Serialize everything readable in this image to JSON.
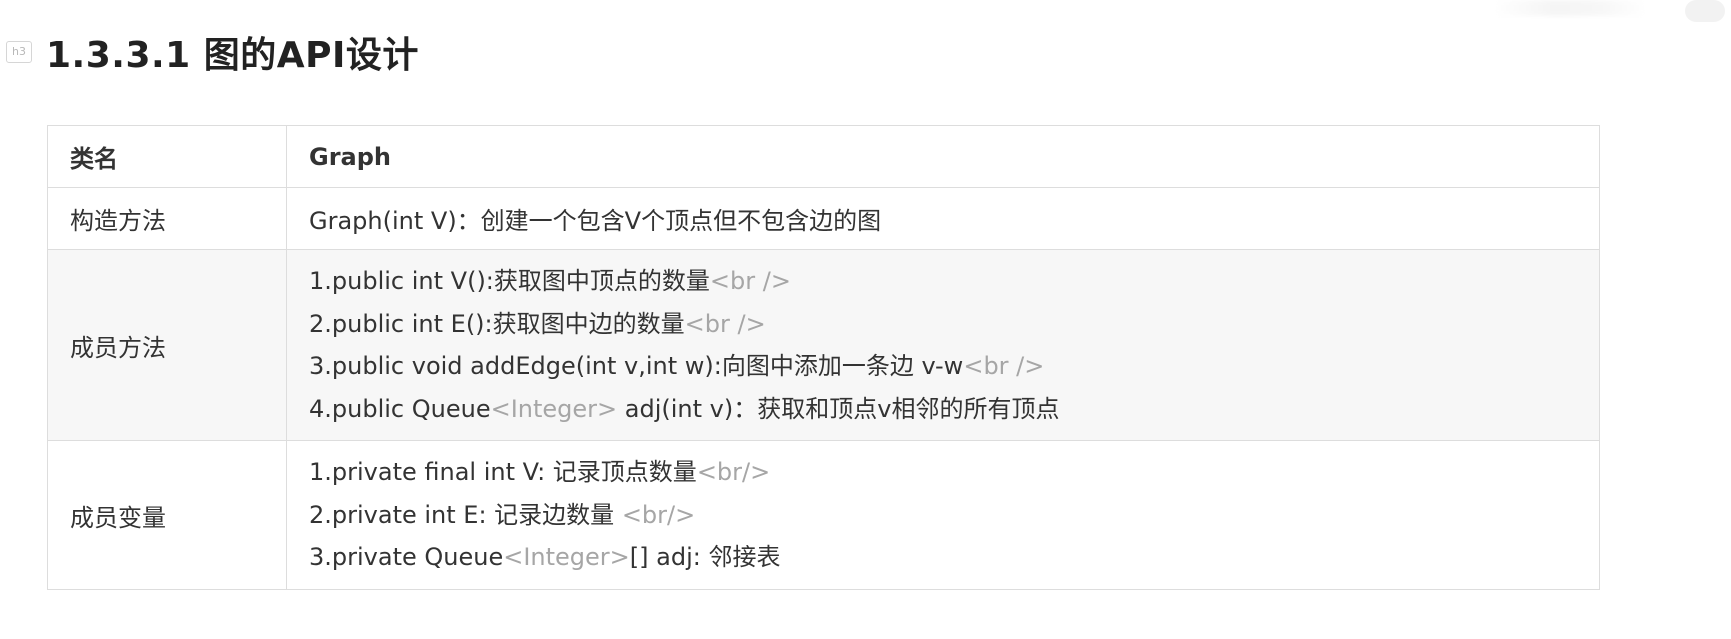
{
  "heading": {
    "tag": "h3",
    "title": "1.3.3.1 图的API设计"
  },
  "table": {
    "header": {
      "label": "类名",
      "value": "Graph"
    },
    "constructor": {
      "label": "构造方法",
      "value": "Graph(int V)：创建一个包含V个顶点但不包含边的图"
    },
    "methods": {
      "label": "成员方法",
      "lines": [
        {
          "text": "1.public int V():获取图中顶点的数量",
          "gray": "<br />",
          "rest": ""
        },
        {
          "text": "2.public int E():获取图中边的数量",
          "gray": "<br />",
          "rest": ""
        },
        {
          "text": "3.public void addEdge(int v,int w):向图中添加一条边 v-w",
          "gray": "<br />",
          "rest": ""
        },
        {
          "text": "4.public Queue",
          "gray": "<Integer>",
          "rest": " adj(int v)：获取和顶点v相邻的所有顶点"
        }
      ]
    },
    "fields": {
      "label": "成员变量",
      "lines": [
        {
          "text": "1.private final int V:  记录顶点数量",
          "gray": "<br/>",
          "rest": ""
        },
        {
          "text": "2.private int E: 记录边数量 ",
          "gray": "<br/>",
          "rest": ""
        },
        {
          "text": "3.private Queue",
          "gray": "<Integer>",
          "rest": "[] adj: 邻接表"
        }
      ]
    }
  }
}
